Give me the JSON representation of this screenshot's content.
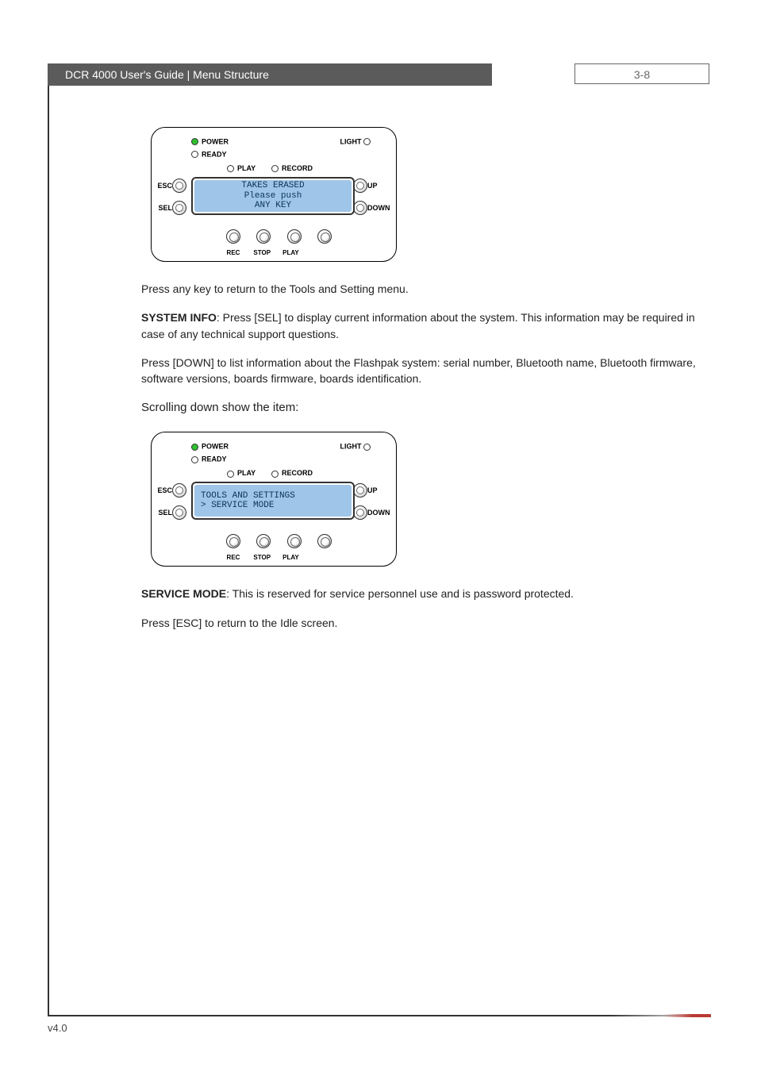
{
  "header": {
    "title_left": "DCR 4000 User's Guide | Menu Structure",
    "page_ref": "3-8"
  },
  "panel1": {
    "power": "POWER",
    "ready": "READY",
    "light": "LIGHT",
    "play": "PLAY",
    "record": "RECORD",
    "esc": "ESC",
    "sel": "SEL",
    "up": "UP",
    "down": "DOWN",
    "rec": "REC",
    "stop": "STOP",
    "play_btn": "PLAY",
    "lcd_line1": "TAKES ERASED",
    "lcd_line2": "Please push",
    "lcd_line3": "ANY KEY"
  },
  "paragraphs": {
    "p1": "Press any key to return to the Tools and Setting menu.",
    "p2_bold": "SYSTEM INFO",
    "p2_rest": ": Press [SEL] to display current information about the system. This information may be required in case of any technical support questions.",
    "p3": "Press [DOWN] to list information about the Flashpak system: serial number, Bluetooth name, Bluetooth firmware, software versions, boards firmware, boards identification.",
    "subhead": "Scrolling down show the item:",
    "p4_bold": "SERVICE MODE",
    "p4_rest": ": This is reserved for service personnel use and is password protected.",
    "p5": "Press [ESC] to return to the Idle screen."
  },
  "panel2": {
    "power": "POWER",
    "ready": "READY",
    "light": "LIGHT",
    "play": "PLAY",
    "record": "RECORD",
    "esc": "ESC",
    "sel": "SEL",
    "up": "UP",
    "down": "DOWN",
    "rec": "REC",
    "stop": "STOP",
    "play_btn": "PLAY",
    "lcd_line1": "TOOLS AND SETTINGS",
    "lcd_line2": ">  SERVICE MODE"
  },
  "footer": {
    "version": "v4.0"
  }
}
